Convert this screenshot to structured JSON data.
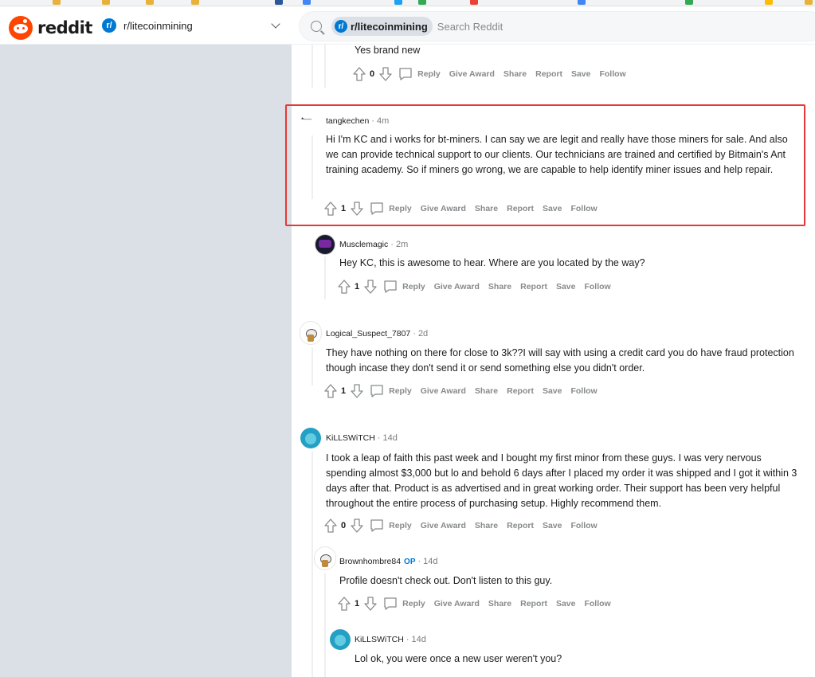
{
  "header": {
    "logo_text": "reddit",
    "community": {
      "icon_glyph": "r/",
      "name": "r/litecoinmining"
    },
    "search": {
      "chip_label": "r/litecoinmining",
      "placeholder": "Search Reddit"
    }
  },
  "action_labels": {
    "reply": "Reply",
    "give_award": "Give Award",
    "share": "Share",
    "report": "Report",
    "save": "Save",
    "follow": "Follow"
  },
  "comments": [
    {
      "body": "Yes brand new",
      "score": "0"
    },
    {
      "author": "tangkechen",
      "time": "4m",
      "body": "Hi I'm KC and i works for bt-miners. I can say we are legit and really have those miners for sale. And also we can provide technical support to our clients. Our technicians are trained and certified by Bitmain's Ant training academy. So if miners go wrong, we are capable to help identify miner issues and help repair.",
      "score": "1",
      "highlighted": true
    },
    {
      "author": "Musclemagic",
      "time": "2m",
      "body": "Hey KC, this is awesome to hear. Where are you located by the way?",
      "score": "1"
    },
    {
      "author": "Logical_Suspect_7807",
      "time": "2d",
      "body": "They have nothing on there for close to 3k??I will say with using a credit card you do have fraud protection though incase they don't send it or send something else you didn't order.",
      "score": "1"
    },
    {
      "author": "KiLLSWiTCH",
      "time": "14d",
      "body": "I took a leap of faith this past week and I bought my first minor from these guys. I was very nervous spending almost $3,000 but lo and behold 6 days after I placed my order it was shipped and I got it within 3 days after that. Product is as advertised and in great working order. Their support has been very helpful throughout the entire process of purchasing setup. Highly recommend them.",
      "score": "0"
    },
    {
      "author": "Brownhombre84",
      "op_label": "OP",
      "time": "14d",
      "body": "Profile doesn't check out. Don't listen to this guy.",
      "score": "1"
    },
    {
      "author": "KiLLSWiTCH",
      "time": "14d",
      "body": "Lol ok, you were once a new user weren't you?"
    }
  ]
}
